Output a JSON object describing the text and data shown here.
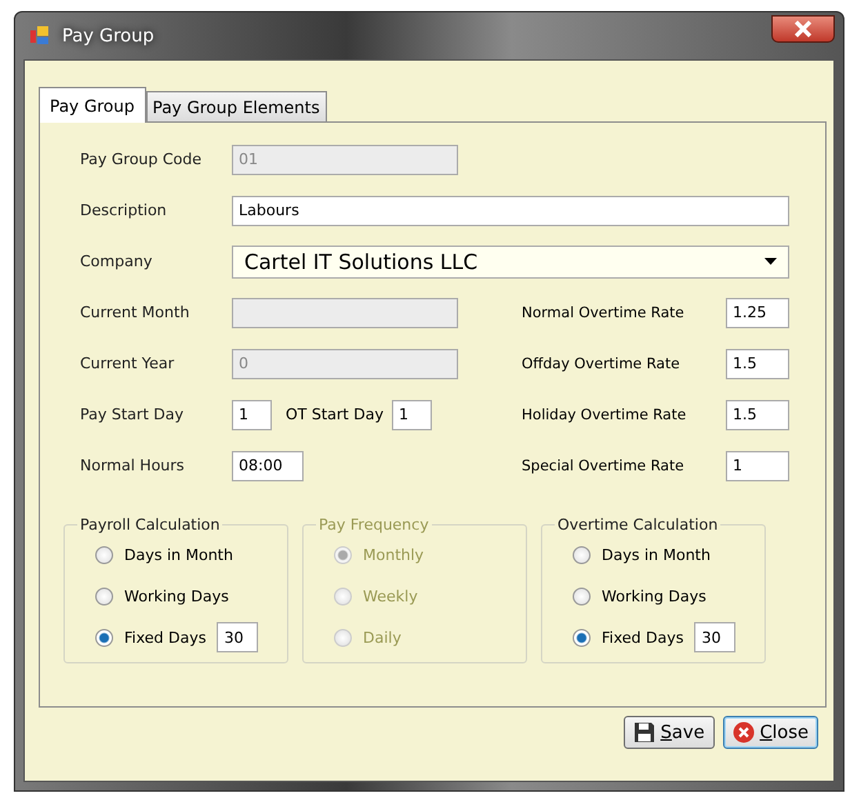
{
  "window": {
    "title": "Pay Group"
  },
  "tabs": [
    {
      "label": "Pay Group",
      "selected": true
    },
    {
      "label": "Pay Group Elements",
      "selected": false
    }
  ],
  "fields": {
    "code": {
      "label": "Pay Group Code",
      "value": "01",
      "disabled": true
    },
    "description": {
      "label": "Description",
      "value": "Labours",
      "disabled": false
    },
    "company": {
      "label": "Company",
      "value": "Cartel IT Solutions LLC"
    }
  },
  "left_fields": [
    {
      "kind": "single",
      "label": "Current Month",
      "disabled": true
    },
    {
      "kind": "single",
      "label": "Current Year",
      "value": "0",
      "disabled": true
    },
    {
      "kind": "pair",
      "label": "Pay Start Day",
      "value": "1",
      "label_2": "OT Start Day",
      "value_2": "1"
    },
    {
      "kind": "short",
      "label": "Normal Hours",
      "value": "08:00",
      "disabled": false
    }
  ],
  "right_fields": [
    {
      "label": "Normal Overtime Rate",
      "value": "1.25"
    },
    {
      "label": "Offday Overtime Rate",
      "value": "1.5"
    },
    {
      "label": "Holiday Overtime Rate",
      "value": "1.5"
    },
    {
      "label": "Special Overtime Rate",
      "value": "1"
    }
  ],
  "groups": [
    {
      "title": "Payroll Calculation",
      "disabled": false,
      "options": [
        {
          "label": "Days in Month",
          "selected": false
        },
        {
          "label": "Working Days",
          "selected": false
        },
        {
          "label": "Fixed Days",
          "selected": true,
          "value": "30"
        }
      ]
    },
    {
      "title": "Pay Frequency",
      "disabled": true,
      "options": [
        {
          "label": "Monthly",
          "selected": true
        },
        {
          "label": "Weekly",
          "selected": false
        },
        {
          "label": "Daily",
          "selected": false
        }
      ]
    },
    {
      "title": "Overtime Calculation",
      "disabled": false,
      "options": [
        {
          "label": "Days in Month",
          "selected": false
        },
        {
          "label": "Working Days",
          "selected": false
        },
        {
          "label": "Fixed Days",
          "selected": true,
          "value": "30"
        }
      ]
    }
  ],
  "buttons": [
    {
      "kind": "save",
      "label": "Save",
      "mnemonic": true
    },
    {
      "kind": "close",
      "label": "Close",
      "mnemonic": true
    }
  ]
}
